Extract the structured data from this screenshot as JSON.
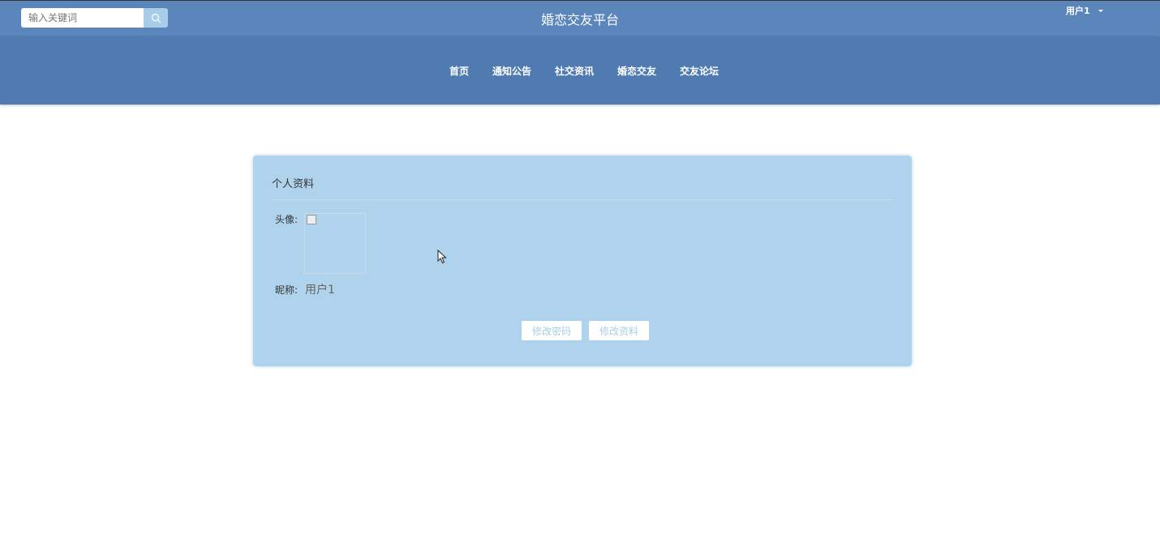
{
  "header": {
    "search": {
      "placeholder": "输入关键词",
      "value": ""
    },
    "site_title": "婚恋交友平台",
    "user": {
      "name": "用户1"
    }
  },
  "nav": {
    "items": [
      {
        "label": "首页"
      },
      {
        "label": "通知公告"
      },
      {
        "label": "社交资讯"
      },
      {
        "label": "婚恋交友"
      },
      {
        "label": "交友论坛"
      }
    ]
  },
  "profile": {
    "title": "个人资料",
    "avatar_label": "头像:",
    "nickname_label": "昵称:",
    "nickname_value": "用户1",
    "change_password_label": "修改密码",
    "edit_profile_label": "修改资料"
  },
  "colors": {
    "topbar": "#5a86bb",
    "navbar": "#4f7bb1",
    "card": "#afd3ed",
    "accent": "#a8cde8"
  },
  "icons": {
    "search": "search-icon",
    "user_menu": "caret-down-icon",
    "cursor": "mouse-pointer-icon"
  }
}
